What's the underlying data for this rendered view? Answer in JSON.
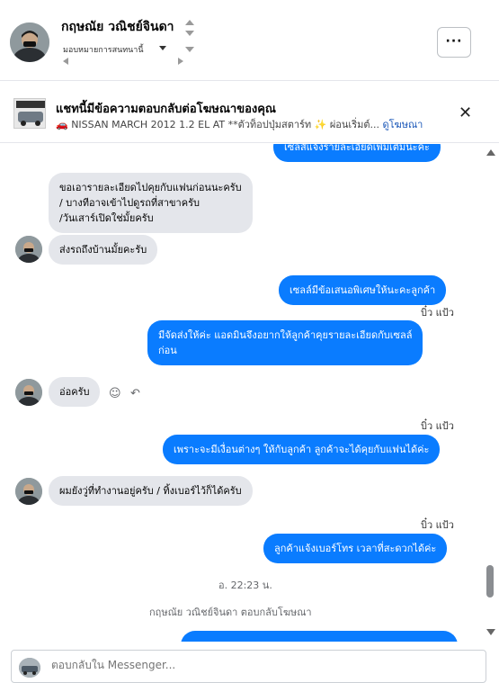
{
  "header": {
    "contact_name": "กฤษณัย วณิชย์จินดา",
    "subtitle": "มอบหมายการสนทนานี้",
    "more_label": "···"
  },
  "ad_banner": {
    "title": "แชทนี้มีข้อความตอบกลับต่อโฆษณาของคุณ",
    "description": "🚗 NISSAN MARCH 2012 1.2 EL AT **ตัวท็อปปุ่มสตาร์ท ✨ ผ่อนเริ่มต์...",
    "link_label": "ดูโฆษณา",
    "close_label": "✕"
  },
  "messages": {
    "partial_top": "เซลส์แจ้งรายละเอียดเพิ่มเติมนะคะ",
    "m1_line1": "ขอเอารายละเอียดไปคุยกับแฟนก่อนนะครับ",
    "m1_line2": "/ บางทีอาจเข้าไปดูรถที่สาขาครับ",
    "m1_line3": "/วันเสาร์เปิดใช่มั้ยครับ",
    "m2": "ส่งรถถึงบ้านมั้ยคะรับ",
    "m3": "เซลล์มีข้อเสนอพิเศษให้นะคะลูกค้า",
    "sender1": "บิ๋ว แป้ว",
    "m4_line1": "มีจัดส่งให้ค่ะ  แอดมินจึงอยากให้ลูกค้าคุยรายละเอียดกับเซลล์",
    "m4_line2": "ก่อน",
    "m5": "อ่อครับ",
    "sender2": "บิ๋ว แป้ว",
    "m6": "เพราะจะมีเงื่อนต่างๆ ให้กับลูกค้า ลูกค้าจะได้คุยกับแฟนได้ค่ะ",
    "m7": "ผมยังวู่ที่ทำงานอยู่ครับ / ทิ้งเบอร์ไว้ก็ได้ครับ",
    "sender3": "บิ๋ว แป้ว",
    "m8": "ลูกค้าแจ้งเบอร์โทร เวลาที่สะดวกได้ค่ะ",
    "timestamp": "อ. 22:23 น.",
    "reply_notice": "กฤษณัย วณิชย์จินดา ตอบกลับโฆษณา"
  },
  "composer": {
    "placeholder": "ตอบกลับใน Messenger..."
  },
  "colors": {
    "outgoing": "#0a7cff",
    "incoming": "#e4e6eb",
    "link": "#1a57b8"
  }
}
